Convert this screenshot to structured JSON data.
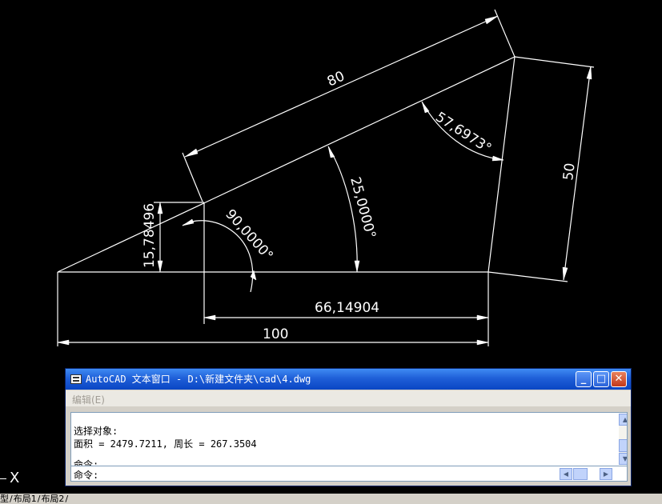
{
  "drawing": {
    "dimensions": {
      "top_edge": "80",
      "right_edge": "50",
      "bottom_total": "100",
      "inner_bottom": "66,14904",
      "left_height": "15,78496",
      "angle_right": "90,0000°",
      "angle_base": "25,0000°",
      "angle_top": "57,6973°"
    }
  },
  "text_window": {
    "title": "AutoCAD 文本窗口 - D:\\新建文件夹\\cad\\4.dwg",
    "menu_edit": "编辑(E)",
    "output_lines": [
      "选择对象:",
      "面积 = 2479.7211, 周长 = 267.3504",
      "命令:"
    ],
    "command_prompt": "命令:",
    "buttons": {
      "minimize": "_",
      "maximize": "□",
      "close": "✕"
    }
  },
  "layout_tabs": {
    "model": "型",
    "layout1": "布局1",
    "layout2": "布局2"
  },
  "ucs_label": "X"
}
